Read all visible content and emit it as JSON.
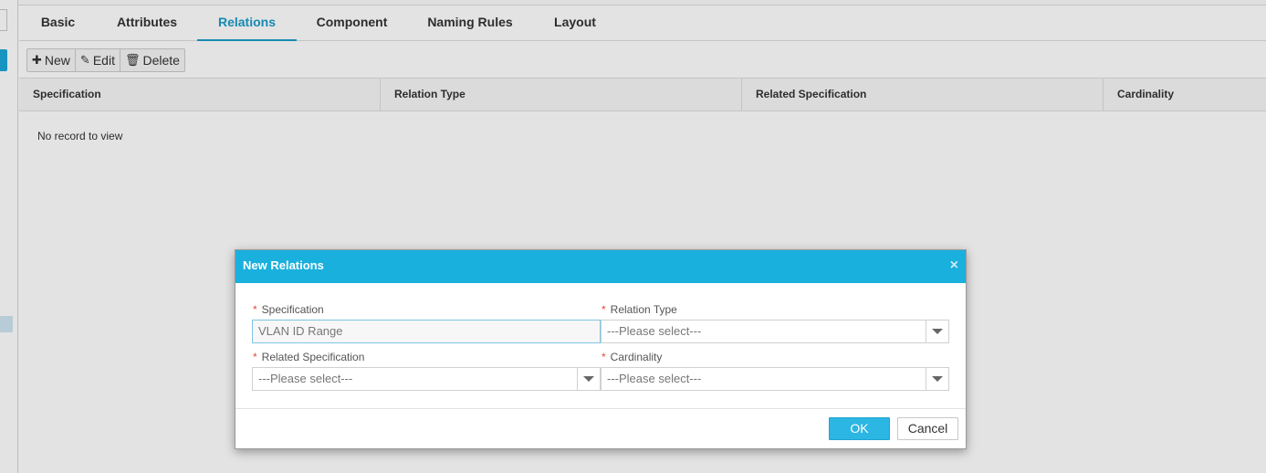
{
  "tabs": [
    {
      "label": "Basic",
      "active": false
    },
    {
      "label": "Attributes",
      "active": false
    },
    {
      "label": "Relations",
      "active": true
    },
    {
      "label": "Component",
      "active": false
    },
    {
      "label": "Naming Rules",
      "active": false
    },
    {
      "label": "Layout",
      "active": false
    }
  ],
  "toolbar": {
    "new_label": "New",
    "edit_label": "Edit",
    "delete_label": "Delete"
  },
  "grid": {
    "columns": [
      "Specification",
      "Relation Type",
      "Related Specification",
      "Cardinality"
    ],
    "empty_message": "No record to view"
  },
  "modal": {
    "title": "New Relations",
    "close_icon": "×",
    "fields": {
      "specification": {
        "label": "Specification",
        "required_mark": "*",
        "value": "VLAN ID Range"
      },
      "relation_type": {
        "label": "Relation Type",
        "required_mark": "*",
        "placeholder": "---Please select---"
      },
      "related_specification": {
        "label": "Related Specification",
        "required_mark": "*",
        "placeholder": "---Please select---"
      },
      "cardinality": {
        "label": "Cardinality",
        "required_mark": "*",
        "placeholder": "---Please select---"
      }
    },
    "ok_label": "OK",
    "cancel_label": "Cancel"
  },
  "colors": {
    "accent": "#1ab0dd",
    "active_tab": "#1a9bc8",
    "required": "#e04b3a"
  }
}
